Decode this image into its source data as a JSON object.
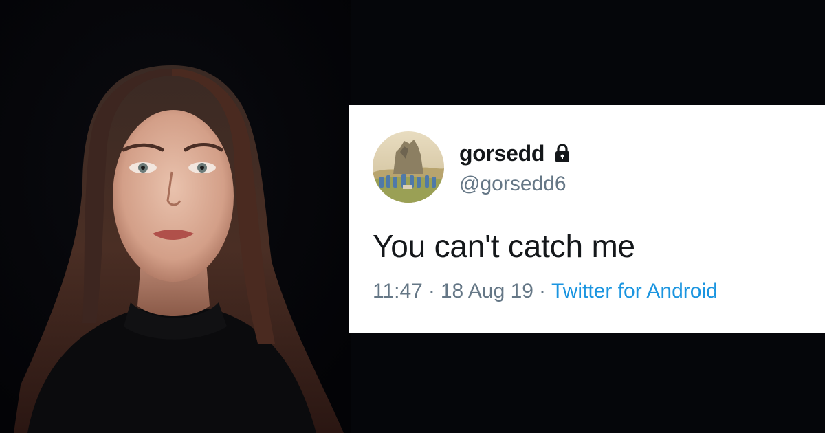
{
  "tweet": {
    "display_name": "gorsedd",
    "handle": "@gorsedd6",
    "text": "You can't catch me",
    "time": "11:47",
    "separator": "·",
    "date": "18 Aug 19",
    "source": "Twitter for Android",
    "protected_icon": "lock-icon",
    "avatar_icon": "painting-avatar"
  },
  "colors": {
    "page_background": "#05060a",
    "card_background": "#ffffff",
    "name_text": "#14171a",
    "secondary_text": "#657786",
    "link": "#1b95e0"
  }
}
